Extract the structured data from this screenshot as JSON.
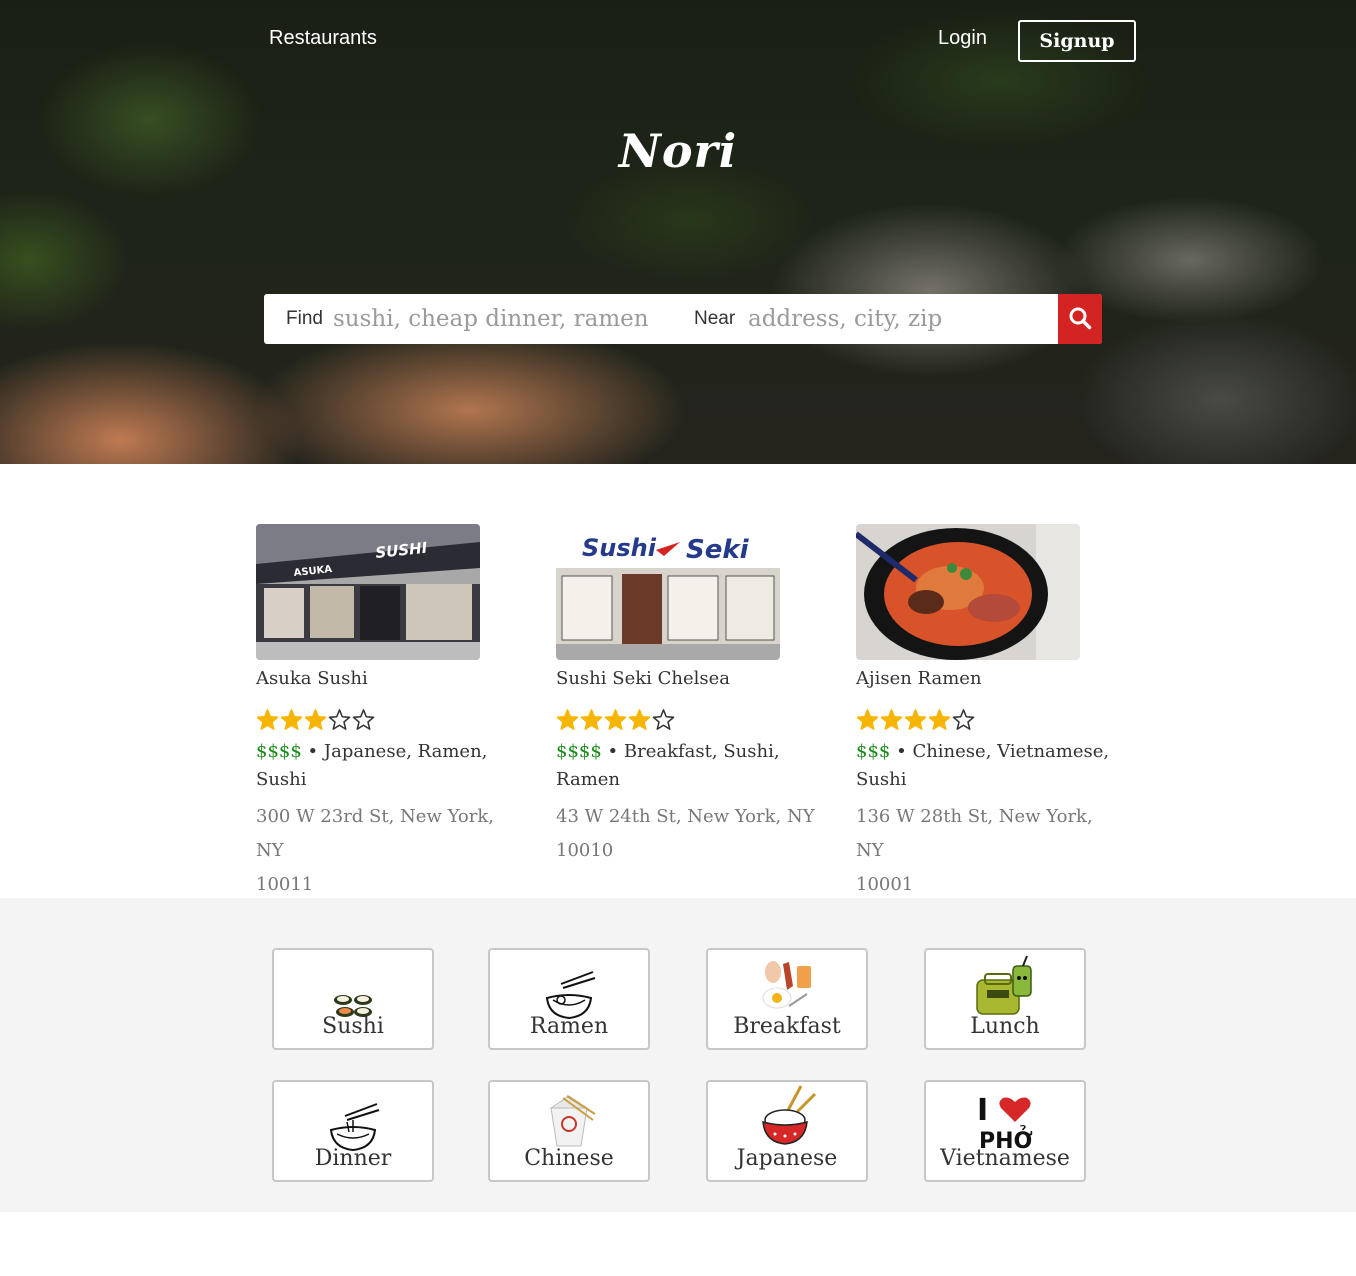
{
  "header": {
    "restaurants_link": "Restaurants",
    "login_link": "Login",
    "signup_button": "Signup",
    "brand": "Nori"
  },
  "search": {
    "find_label": "Find",
    "find_placeholder": "sushi, cheap dinner, ramen",
    "near_label": "Near",
    "near_placeholder": "address, city, zip"
  },
  "colors": {
    "accent_red": "#d32323",
    "price_green": "#1a8a1a",
    "star_gold": "#f7b500"
  },
  "restaurants": [
    {
      "name": "Asuka Sushi",
      "rating": 3,
      "rating_max": 5,
      "price": "$$$$",
      "categories": "Japanese, Ramen,",
      "categories_2": "Sushi",
      "address_line1": "300 W 23rd St, New York, NY",
      "address_line2": "10011"
    },
    {
      "name": "Sushi Seki Chelsea",
      "rating": 4,
      "rating_max": 5,
      "price": "$$$$",
      "categories": "Breakfast, Sushi,",
      "categories_2": "Ramen",
      "address_line1": "43 W 24th St, New York, NY",
      "address_line2": "10010"
    },
    {
      "name": "Ajisen Ramen",
      "rating": 4,
      "rating_max": 5,
      "price": "$$$",
      "categories": "Chinese, Vietnamese,",
      "categories_2": "Sushi",
      "address_line1": "136 W 28th St, New York, NY",
      "address_line2": "10001"
    }
  ],
  "categories": [
    {
      "label": "Sushi",
      "icon": "sushi-icon"
    },
    {
      "label": "Ramen",
      "icon": "ramen-bowl-icon"
    },
    {
      "label": "Breakfast",
      "icon": "breakfast-icon"
    },
    {
      "label": "Lunch",
      "icon": "lunch-bag-icon"
    },
    {
      "label": "Dinner",
      "icon": "noodle-bowl-icon"
    },
    {
      "label": "Chinese",
      "icon": "takeout-box-icon"
    },
    {
      "label": "Japanese",
      "icon": "rice-bowl-icon"
    },
    {
      "label": "Vietnamese",
      "icon": "i-love-pho-icon"
    }
  ]
}
